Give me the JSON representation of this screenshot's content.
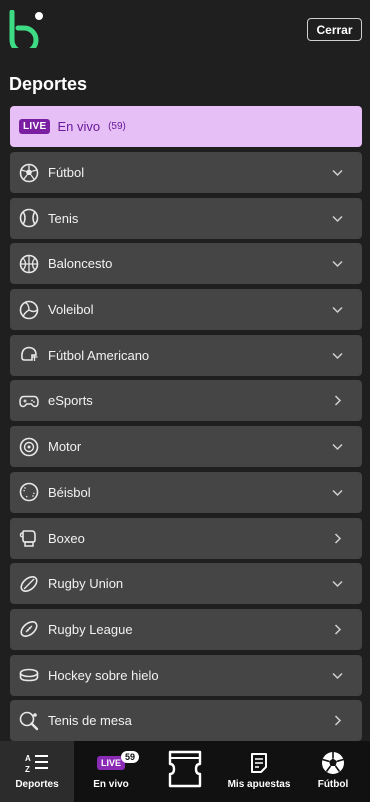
{
  "header": {
    "close_label": "Cerrar"
  },
  "section_title": "Deportes",
  "live": {
    "badge": "LIVE",
    "label": "En vivo",
    "count": "(59)"
  },
  "sports": [
    {
      "label": "Fútbol",
      "icon": "soccer-ball-icon",
      "arrow": "chevron-down"
    },
    {
      "label": "Tenis",
      "icon": "tennis-ball-icon",
      "arrow": "chevron-down"
    },
    {
      "label": "Baloncesto",
      "icon": "basketball-icon",
      "arrow": "chevron-down"
    },
    {
      "label": "Voleibol",
      "icon": "volleyball-icon",
      "arrow": "chevron-down"
    },
    {
      "label": "Fútbol Americano",
      "icon": "football-helmet-icon",
      "arrow": "chevron-down"
    },
    {
      "label": "eSports",
      "icon": "gamepad-icon",
      "arrow": "chevron-right"
    },
    {
      "label": "Motor",
      "icon": "wheel-icon",
      "arrow": "chevron-down"
    },
    {
      "label": "Béisbol",
      "icon": "baseball-icon",
      "arrow": "chevron-down"
    },
    {
      "label": "Boxeo",
      "icon": "boxing-glove-icon",
      "arrow": "chevron-right"
    },
    {
      "label": "Rugby Union",
      "icon": "rugby-ball-icon",
      "arrow": "chevron-down"
    },
    {
      "label": "Rugby League",
      "icon": "rugby-ball-alt-icon",
      "arrow": "chevron-right"
    },
    {
      "label": "Hockey sobre hielo",
      "icon": "hockey-puck-icon",
      "arrow": "chevron-down"
    },
    {
      "label": "Tenis de mesa",
      "icon": "ping-pong-icon",
      "arrow": "chevron-right"
    }
  ],
  "bottom_nav": {
    "deportes": "Deportes",
    "live_badge": "LIVE",
    "live_count": "59",
    "en_vivo": "En vivo",
    "mis_apuestas": "Mis apuestas",
    "futbol": "Fútbol"
  },
  "colors": {
    "brand_green": "#3ddc84",
    "live_bg": "#e6bff6",
    "live_purple": "#7a1fa2",
    "row_bg": "#454545"
  }
}
